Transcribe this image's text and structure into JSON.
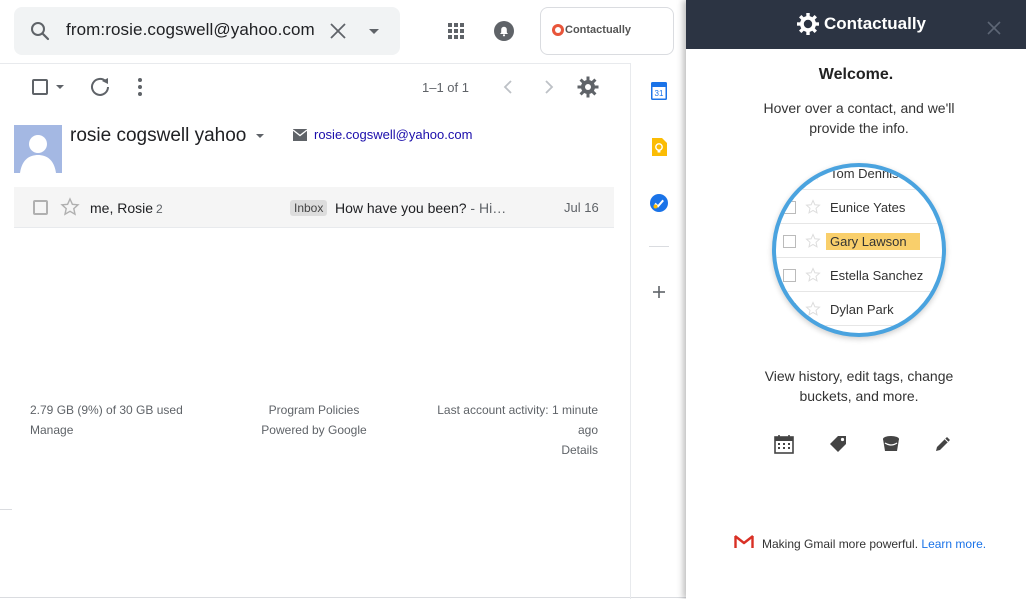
{
  "search": {
    "value": "from:rosie.cogswell@yahoo.com"
  },
  "header": {
    "addon_label": "Contactually"
  },
  "toolbar": {
    "pager_count": "1–1 of 1"
  },
  "contact": {
    "name": "rosie cogswell yahoo",
    "email": "rosie.cogswell@yahoo.com"
  },
  "thread": {
    "senders": "me, Rosie",
    "count": "2",
    "label": "Inbox",
    "subject": "How have you been?",
    "snippet": " - Hi…",
    "date": "Jul 16"
  },
  "footer": {
    "storage": "2.79 GB (9%) of 30 GB used",
    "manage": "Manage",
    "program_policies": "Program Policies",
    "powered_by": "Powered by Google",
    "activity_line1": "Last account activity: 1 minute",
    "activity_line2": "ago",
    "details": "Details"
  },
  "sidestrip": {
    "calendar_day": "31"
  },
  "panel": {
    "title": "Contactually",
    "welcome": "Welcome.",
    "hover_text": "Hover over a contact, and we'll provide the info.",
    "magnifier_names": [
      "Tom Dennis",
      "Eunice Yates",
      "Gary Lawson",
      "Estella Sanchez",
      "Dylan Park"
    ],
    "highlighted_name": "Gary Lawson",
    "view_text": "View history, edit tags, change buckets, and more.",
    "feature_icons": [
      "calendar-icon",
      "tag-icon",
      "bucket-icon",
      "pencil-icon"
    ],
    "footer_text": "Making Gmail more powerful.",
    "footer_link": "Learn more."
  },
  "colors": {
    "panel_header": "#2c3443",
    "magnifier_border": "#4aa3df",
    "highlight": "#f9cf6b",
    "link": "#1a73e8"
  }
}
